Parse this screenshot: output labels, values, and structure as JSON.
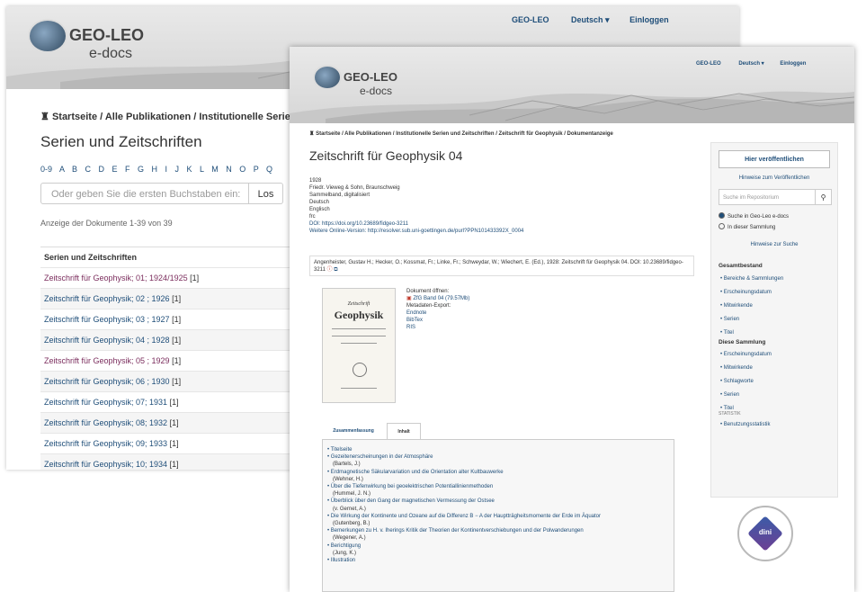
{
  "window1": {
    "nav": [
      "GEO-LEO",
      "Deutsch ▾",
      "Einloggen"
    ],
    "logo": {
      "line1": "GEO-LEO",
      "line2": "e-docs"
    },
    "breadcrumb": "Startseite  /  Alle Publikationen  /  Institutionelle Serien u",
    "heading": "Serien und Zeitschriften",
    "alphabet": "0-9 A B C D E F G H I J K L M N O P Q",
    "search": {
      "placeholder": "Oder geben Sie die ersten Buchstaben ein:",
      "button": "Los"
    },
    "count": "Anzeige der Dokumente 1-39 von 39",
    "table": {
      "header": "Serien und Zeitschriften",
      "rows": [
        {
          "title": "Zeitschrift für Geophysik; 01; 1924/1925",
          "count": "[1]",
          "visited": true
        },
        {
          "title": "Zeitschrift für Geophysik; 02 ; 1926",
          "count": "[1]",
          "visited": false
        },
        {
          "title": "Zeitschrift für Geophysik; 03 ; 1927",
          "count": "[1]",
          "visited": false
        },
        {
          "title": "Zeitschrift für Geophysik; 04 ; 1928",
          "count": "[1]",
          "visited": false
        },
        {
          "title": "Zeitschrift für Geophysik; 05 ; 1929",
          "count": "[1]",
          "visited": true
        },
        {
          "title": "Zeitschrift für Geophysik; 06 ; 1930",
          "count": "[1]",
          "visited": false
        },
        {
          "title": "Zeitschrift für Geophysik; 07; 1931",
          "count": "[1]",
          "visited": false
        },
        {
          "title": "Zeitschrift für Geophysik; 08; 1932",
          "count": "[1]",
          "visited": false
        },
        {
          "title": "Zeitschrift für Geophysik; 09; 1933",
          "count": "[1]",
          "visited": false
        },
        {
          "title": "Zeitschrift für Geophysik; 10; 1934",
          "count": "[1]",
          "visited": false
        }
      ]
    }
  },
  "window2": {
    "nav": [
      "GEO-LEO",
      "Deutsch ▾",
      "Einloggen"
    ],
    "logo": {
      "line1": "GEO-LEO",
      "line2": "e-docs"
    },
    "breadcrumb": "Startseite  /  Alle Publikationen  /  Institutionelle Serien und Zeitschriften  /  Zeitschrift für Geophysik  /  Dokumentanzeige",
    "heading": "Zeitschrift für Geophysik 04",
    "meta": [
      "1928",
      "Friedr. Vieweg & Sohn, Braunschweig",
      "Sammelband, digitalisiert",
      "Deutsch",
      "Englisch",
      "frc",
      "DOI: https://doi.org/10.23689/fidgeo-3211",
      "Weitere Online-Version: http://resolver.sub.uni-goettingen.de/purl?PPN101433392X_0004"
    ],
    "citation": "Angenheister, Gustav H.; Hecker, O.; Kossmat, Fr.; Linke, Fr.; Schweydar, W.; Wiechert, E. (Ed.), 1928: Zeitschrift für Geophysik 04. DOI: 10.23689/fidgeo-3211",
    "thumbnail": {
      "title_small": "Zeitschrift",
      "title_big": "Geophysik"
    },
    "document": {
      "open_label": "Dokument öffnen:",
      "file": "ZfG Band 04 (79.57Mb)",
      "export_label": "Metadaten-Export:",
      "exports": [
        "Endnote",
        "BibTex",
        "RIS"
      ]
    },
    "tabs": [
      "Zusammenfassung",
      "Inhalt"
    ],
    "toc": [
      {
        "title": "Titelseite",
        "author": ""
      },
      {
        "title": "Gezeitenerscheinungen in der Atmosphäre",
        "author": "(Bartels, J.)"
      },
      {
        "title": "Erdmagnetische Säkularvariation und die Orientation alter Kultbauwerke",
        "author": "(Wehner, H.)"
      },
      {
        "title": "Über die Tiefenwirkung bei geoelektrischen Potentiallinienmethoden",
        "author": "(Hummel, J. N.)"
      },
      {
        "title": "Überblick über den Gang der magnetischen Vermessung der Ostsee",
        "author": "(v. Gernet, A.)"
      },
      {
        "title": "Die Wirkung der Kontinente und Ozeane auf die Differenz B − A der Hauptträgheitsmomente der Erde im Äquator",
        "author": "(Gutenberg, B.)"
      },
      {
        "title": "Bemerkungen zu H. v. Iherings Kritik der Theorien der Kontinentverschiebungen und der Polwanderungen",
        "author": "(Wegener, A.)"
      },
      {
        "title": "Berichtigung",
        "author": "(Jung, K.)"
      },
      {
        "title": "Illustration",
        "author": ""
      }
    ],
    "sidebar": {
      "publish_button": "Hier veröffentlichen",
      "publish_hint": "Hinweise zum Veröffentlichen",
      "search_placeholder": "Suche im Repositorium",
      "radio1": "Suche in Geo-Leo e-docs",
      "radio2": "In dieser Sammlung",
      "search_hint": "Hinweise zur Suche",
      "section1": "Gesamtbestand",
      "items1": [
        "Bereiche & Sammlungen",
        "Erscheinungsdatum",
        "Mitwirkende",
        "Serien",
        "Titel"
      ],
      "section2": "Diese Sammlung",
      "items2": [
        "Erscheinungsdatum",
        "Mitwirkende",
        "Schlagworte",
        "Serien",
        "Titel"
      ],
      "stats_label": "STATISTIK",
      "stats_item": "Benutzungsstatistik"
    },
    "badge": "dini"
  }
}
